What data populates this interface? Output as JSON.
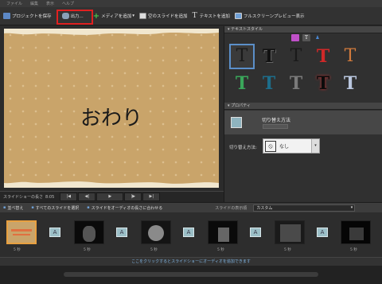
{
  "menubar": [
    "ファイル",
    "編集",
    "表示",
    "ヘルプ"
  ],
  "toolbar": {
    "save_label": "プロジェクトを保存",
    "output_label": "出力...",
    "add_media_label": "メディアを追加",
    "add_blank_label": "空のスライドを追加",
    "add_text_label": "テキストを追加",
    "fullscreen_label": "フルスクリーンプレビュー表示"
  },
  "preview": {
    "text": "おわり"
  },
  "controls": {
    "duration_label": "スライドショーの長さ",
    "duration_value": "8:05"
  },
  "panel": {
    "styles_header": "テキストスタイル",
    "properties_header": "プロパティ",
    "transition_name": "切り替え方法",
    "transition_label": "切り替え方法:",
    "transition_value": "なし"
  },
  "timeline_bar": {
    "sort_label": "並べ替え",
    "select_all_label": "すべてのスライドを選択",
    "fit_audio_label": "スライドをオーディオの長さに合わせる",
    "view_label": "スライドの表示順",
    "view_value": "カスタム"
  },
  "timeline_footer": "ここをクリックするとスライドショーにオーディオを追加できます",
  "slides": [
    {
      "duration": "5 秒"
    },
    {
      "duration": "5 秒"
    },
    {
      "duration": "5 秒"
    },
    {
      "duration": "5 秒"
    },
    {
      "duration": "5 秒"
    },
    {
      "duration": "5 秒"
    }
  ],
  "colors": {
    "accent": "#5b8fc9",
    "highlight": "#e02020",
    "card": "#c9a46a"
  }
}
